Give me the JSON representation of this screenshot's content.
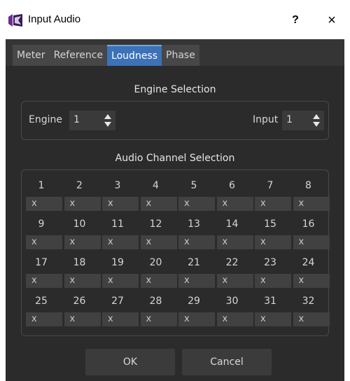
{
  "window": {
    "title": "Input Audio",
    "help_label": "?",
    "close_label": "×"
  },
  "tabs": [
    {
      "label": "Meter",
      "active": false
    },
    {
      "label": "Reference",
      "active": false
    },
    {
      "label": "Loudness",
      "active": true
    },
    {
      "label": "Phase",
      "active": false
    }
  ],
  "engine_section": {
    "title": "Engine Selection",
    "engine_label": "Engine",
    "engine_value": "1",
    "input_label": "Input",
    "input_value": "1"
  },
  "channel_section": {
    "title": "Audio Channel Selection",
    "rows": [
      {
        "numbers": [
          "1",
          "2",
          "3",
          "4",
          "5",
          "6",
          "7",
          "8"
        ],
        "values": [
          "x",
          "x",
          "x",
          "x",
          "x",
          "x",
          "x",
          "x"
        ]
      },
      {
        "numbers": [
          "9",
          "10",
          "11",
          "12",
          "13",
          "14",
          "15",
          "16"
        ],
        "values": [
          "x",
          "x",
          "x",
          "x",
          "x",
          "x",
          "x",
          "x"
        ]
      },
      {
        "numbers": [
          "17",
          "18",
          "19",
          "20",
          "21",
          "22",
          "23",
          "24"
        ],
        "values": [
          "x",
          "x",
          "x",
          "x",
          "x",
          "x",
          "x",
          "x"
        ]
      },
      {
        "numbers": [
          "25",
          "26",
          "27",
          "28",
          "29",
          "30",
          "31",
          "32"
        ],
        "values": [
          "x",
          "x",
          "x",
          "x",
          "x",
          "x",
          "x",
          "x"
        ]
      }
    ]
  },
  "buttons": {
    "ok_label": "OK",
    "cancel_label": "Cancel"
  },
  "colors": {
    "accent": "#3d71b8",
    "background": "#2b2b2b"
  }
}
